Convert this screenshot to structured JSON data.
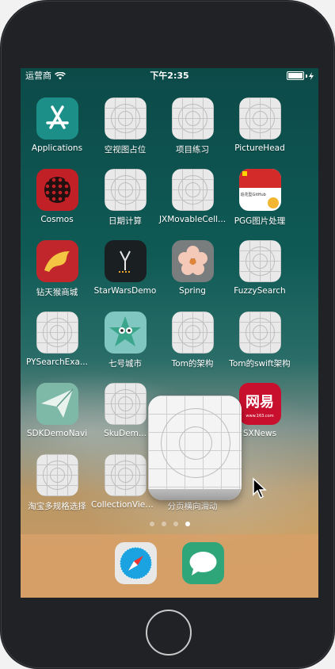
{
  "status": {
    "carrier": "运营商",
    "time": "下午2:35",
    "battery_level": 0.95
  },
  "apps": [
    {
      "label": "Applications",
      "icon": "appstore-icon"
    },
    {
      "label": "空视图占位",
      "icon": "placeholder-icon"
    },
    {
      "label": "项目练习",
      "icon": "placeholder-icon"
    },
    {
      "label": "PictureHead",
      "icon": "placeholder-icon"
    },
    {
      "label": "Cosmos",
      "icon": "cosmos-icon"
    },
    {
      "label": "日期计算",
      "icon": "placeholder-icon"
    },
    {
      "label": "JXMovableCell...",
      "icon": "placeholder-icon"
    },
    {
      "label": "PGG图片处理",
      "icon": "pgg-icon"
    },
    {
      "label": "钻天猴商城",
      "icon": "horse-icon"
    },
    {
      "label": "StarWarsDemo",
      "icon": "starwars-icon"
    },
    {
      "label": "Spring",
      "icon": "flower-icon"
    },
    {
      "label": "FuzzySearch",
      "icon": "placeholder-icon"
    },
    {
      "label": "PYSearchExa...",
      "icon": "placeholder-icon"
    },
    {
      "label": "七号城市",
      "icon": "seven-city-icon"
    },
    {
      "label": "Tom的架构",
      "icon": "placeholder-icon"
    },
    {
      "label": "Tom的swift架构",
      "icon": "placeholder-icon"
    },
    {
      "label": "SDKDemoNavi",
      "icon": "paper-plane-icon"
    },
    {
      "label": "SkuDem...",
      "icon": "placeholder-icon"
    },
    {
      "label": "SXNews",
      "icon": "news-icon"
    },
    {
      "label": "淘宝多规格选择",
      "icon": "placeholder-icon"
    },
    {
      "label": "CollectionViewH...",
      "icon": "placeholder-icon"
    },
    {
      "label": "分页横向滑动",
      "icon": "placeholder-icon"
    }
  ],
  "pgg_badge": "追花型GitHub",
  "news_text": "网易",
  "news_url": "www.163.com",
  "page_indicator": {
    "pages": 4,
    "current": 4
  },
  "dock": [
    {
      "label": "Safari",
      "icon": "safari-icon"
    },
    {
      "label": "Messages",
      "icon": "messages-icon"
    }
  ]
}
